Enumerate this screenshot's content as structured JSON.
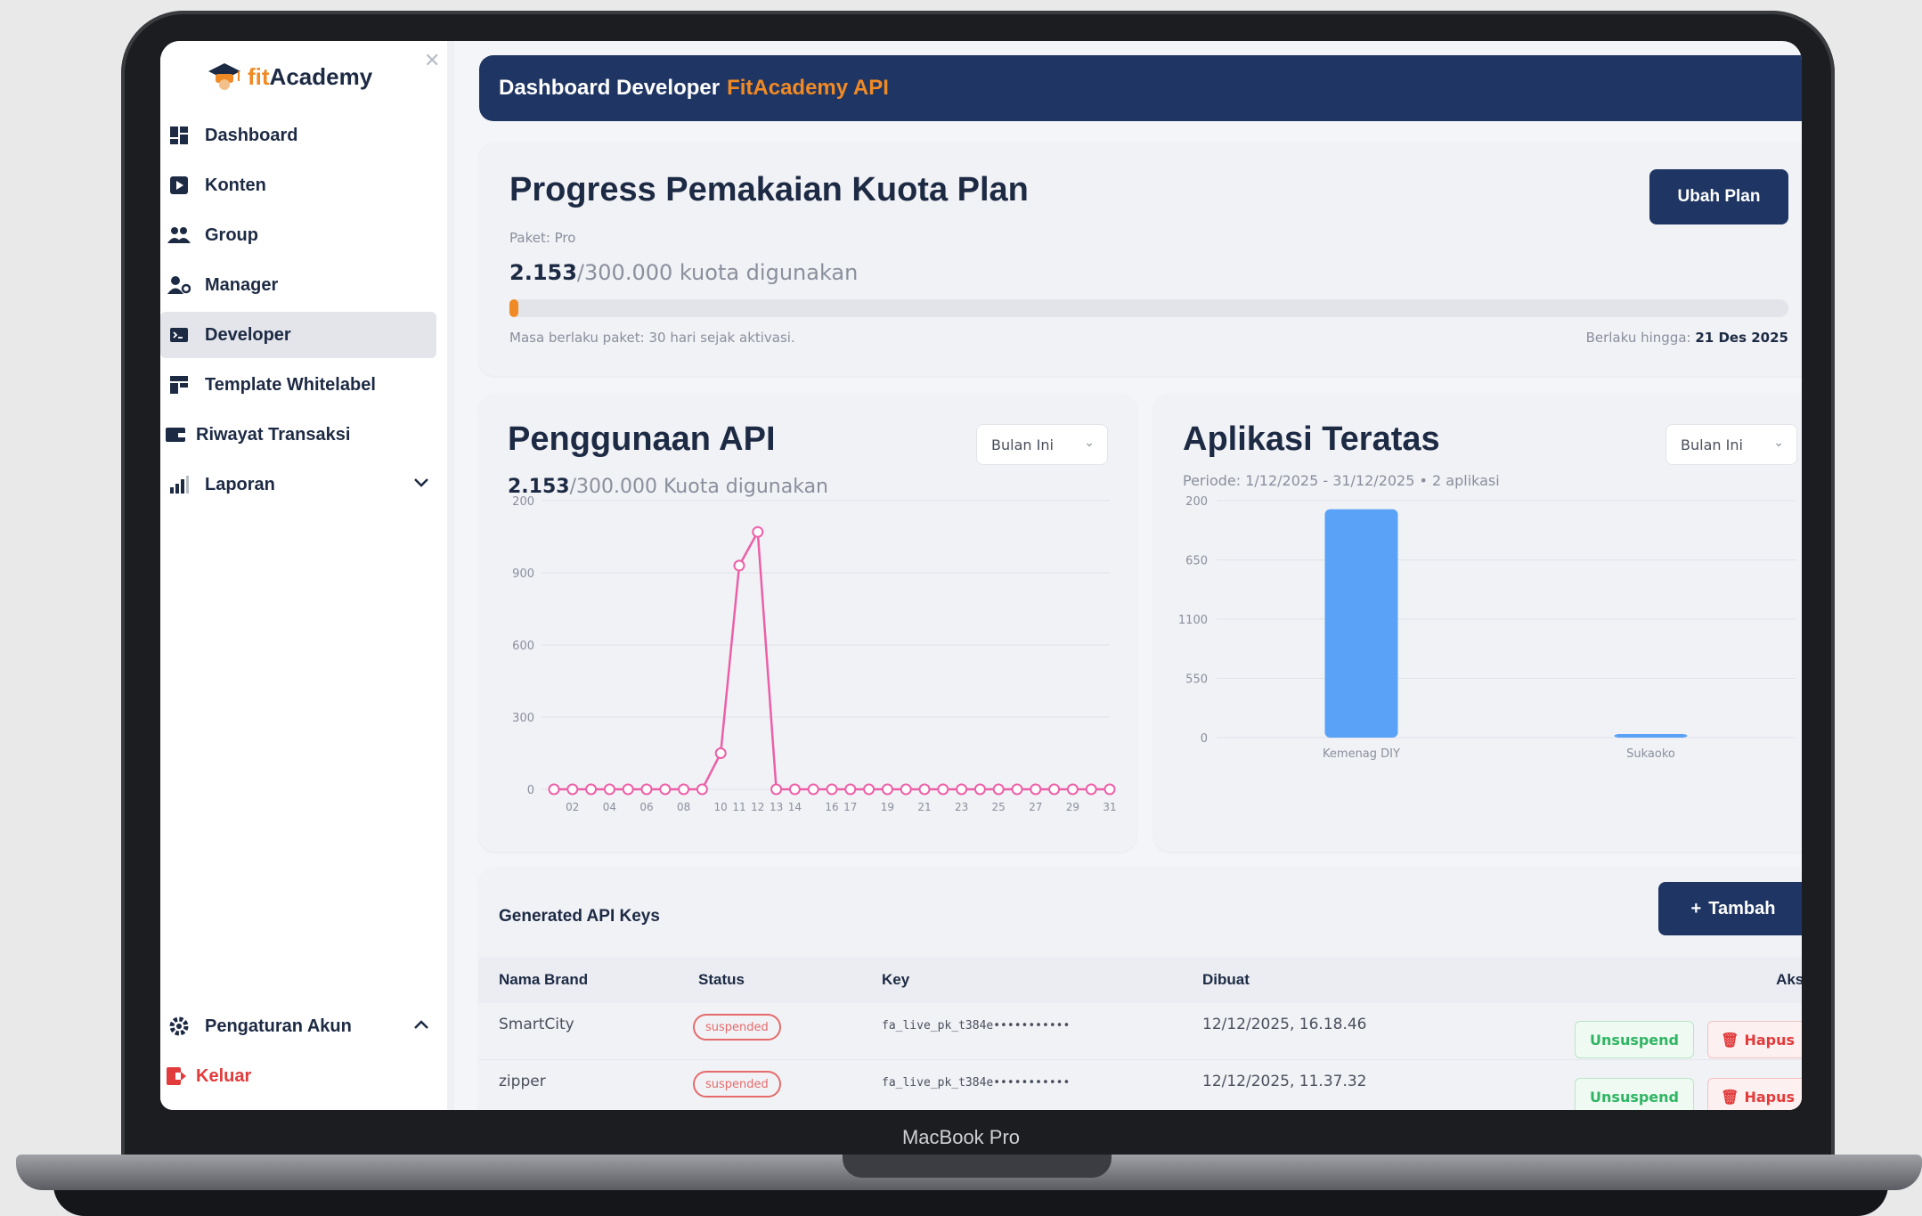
{
  "device_label": "MacBook Pro",
  "brand": {
    "fit": "fit",
    "academy": "Academy"
  },
  "sidebar": {
    "items": [
      {
        "label": "Dashboard",
        "icon": "dashboard-icon"
      },
      {
        "label": "Konten",
        "icon": "play-icon"
      },
      {
        "label": "Group",
        "icon": "group-icon"
      },
      {
        "label": "Manager",
        "icon": "manager-icon"
      },
      {
        "label": "Developer",
        "icon": "terminal-icon",
        "active": true
      },
      {
        "label": "Template Whitelabel",
        "icon": "template-icon"
      },
      {
        "label": "Riwayat Transaksi",
        "icon": "wallet-icon"
      },
      {
        "label": "Laporan",
        "icon": "bar-chart-icon"
      }
    ],
    "account_label": "Pengaturan Akun",
    "logout_label": "Keluar"
  },
  "header": {
    "title": "Dashboard Developer",
    "accent": "FitAcademy API"
  },
  "quota": {
    "title": "Progress Pemakaian Kuota Plan",
    "paket": "Paket: Pro",
    "used_value": "2.153",
    "used_rest": "/300.000 kuota digunakan",
    "progress_fraction": 0.0072,
    "masa": "Masa berlaku paket: 30 hari sejak aktivasi.",
    "berlaku_label": "Berlaku hingga:",
    "berlaku_date": "21 Des 2025",
    "button": "Ubah Plan"
  },
  "api_usage": {
    "title": "Penggunaan API",
    "used_value": "2.153",
    "used_rest": "/300.000  Kuota digunakan",
    "filter": "Bulan Ini"
  },
  "top_apps": {
    "title": "Aplikasi Teratas",
    "periode": "Periode: 1/12/2025 - 31/12/2025 • 2 aplikasi",
    "filter": "Bulan Ini"
  },
  "chart_data": [
    {
      "type": "line",
      "title": "Penggunaan API",
      "y_ticks": [
        "0",
        "300",
        "600",
        "900",
        "200"
      ],
      "ylim": [
        0,
        1200
      ],
      "x_tick_labels": [
        "02",
        "04",
        "06",
        "08",
        "10",
        "11",
        "12",
        "13",
        "14",
        "16",
        "17",
        "19",
        "21",
        "23",
        "25",
        "27",
        "29",
        "31"
      ],
      "x": [
        1,
        2,
        3,
        4,
        5,
        6,
        7,
        8,
        9,
        10,
        11,
        12,
        13,
        14,
        15,
        16,
        17,
        18,
        19,
        20,
        21,
        22,
        23,
        24,
        25,
        26,
        27,
        28,
        29,
        30,
        31
      ],
      "values": [
        0,
        0,
        0,
        0,
        0,
        0,
        0,
        0,
        0,
        150,
        930,
        1070,
        0,
        0,
        0,
        0,
        0,
        0,
        0,
        0,
        0,
        0,
        0,
        0,
        0,
        0,
        0,
        0,
        0,
        0,
        0
      ],
      "color": "#ec5fa8",
      "grid": true
    },
    {
      "type": "bar",
      "title": "Aplikasi Teratas",
      "y_ticks": [
        "0",
        "550",
        "1100",
        "650",
        "200"
      ],
      "ylim": [
        0,
        2200
      ],
      "categories": [
        "Kemenag DIY",
        "Sukaoko"
      ],
      "values": [
        2120,
        33
      ],
      "color": "#5aa2f7",
      "grid": true
    }
  ],
  "keys": {
    "title": "Generated API Keys",
    "add_button": "Tambah",
    "columns": [
      "Nama Brand",
      "Status",
      "Key",
      "Dibuat",
      "Aksi"
    ],
    "rows": [
      {
        "brand": "SmartCity",
        "status": "suspended",
        "key": "fa_live_pk_t384e•••••••••••",
        "created": "12/12/2025, 16.18.46"
      },
      {
        "brand": "zipper",
        "status": "suspended",
        "key": "fa_live_pk_t384e•••••••••••",
        "created": "12/12/2025, 11.37.32"
      }
    ],
    "unsuspend_label": "Unsuspend",
    "delete_label": "Hapus"
  },
  "colors": {
    "navy": "#1f3563",
    "orange": "#f08a24",
    "pink": "#ec5fa8",
    "blue": "#5aa2f7",
    "green": "#2fb563",
    "red": "#e23b3b"
  }
}
